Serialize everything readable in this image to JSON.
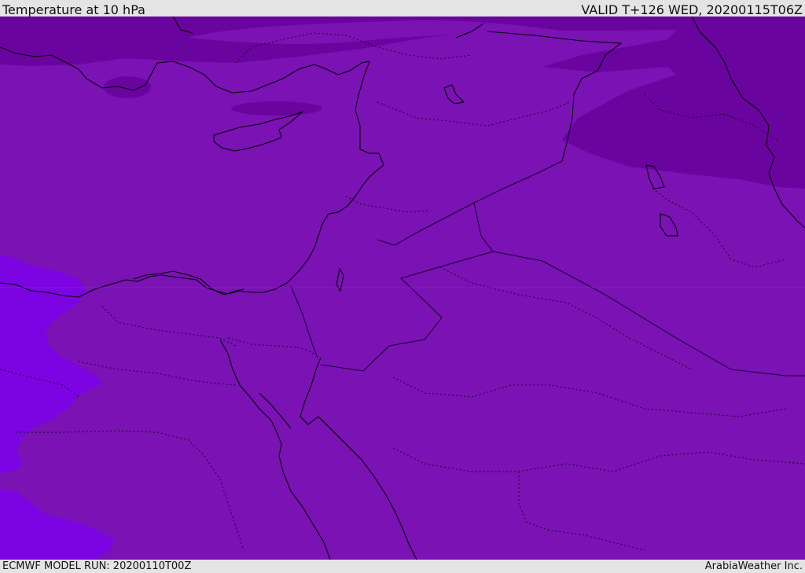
{
  "header": {
    "title": "Temperature at 10 hPa",
    "valid": "VALID T+126 WED, 20200115T06Z"
  },
  "footer": {
    "model_run": "ECMWF MODEL RUN: 20200110T00Z",
    "credit": "ArabiaWeather Inc."
  },
  "map": {
    "region": "Eastern Mediterranean and Middle East",
    "field": "temperature",
    "pressure_level": "10 hPa",
    "colors": {
      "base_fill": "#7a12b4",
      "cold_band": "#6a049e",
      "warm_band": "#7c04e2",
      "coastline": "#000000",
      "border": "#1a0030",
      "frame": "#e4e4e4"
    }
  }
}
